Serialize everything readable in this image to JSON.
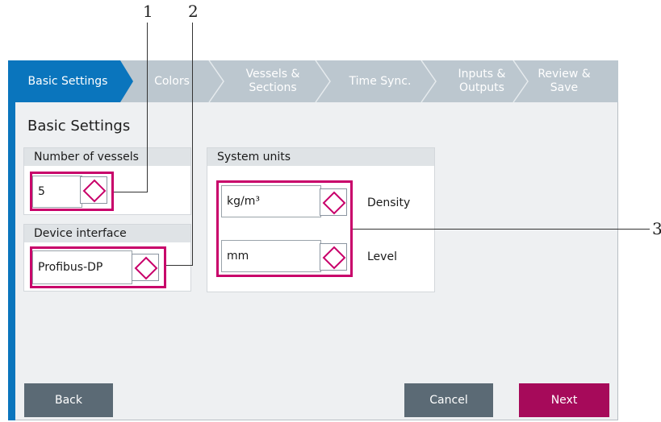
{
  "callouts": [
    "1",
    "2",
    "3"
  ],
  "wizard": {
    "steps": [
      {
        "label": "Basic Settings"
      },
      {
        "label": "Colors"
      },
      {
        "label": "Vessels &\nSections"
      },
      {
        "label": "Time Sync."
      },
      {
        "label": "Inputs &\nOutputs"
      },
      {
        "label": "Review &\nSave"
      }
    ]
  },
  "page": {
    "title": "Basic Settings"
  },
  "vessels": {
    "heading": "Number of vessels",
    "value": "5"
  },
  "device": {
    "heading": "Device interface",
    "value": "Profibus-DP"
  },
  "units": {
    "heading": "System units",
    "density": {
      "value": "kg/m³",
      "label": "Density"
    },
    "level": {
      "value": "mm",
      "label": "Level"
    }
  },
  "buttons": {
    "back": "Back",
    "cancel": "Cancel",
    "next": "Next"
  },
  "colors": {
    "accent": "#0a75bd",
    "highlight": "#c8006a",
    "next": "#a60a5a",
    "gray_button": "#5b6a75"
  }
}
